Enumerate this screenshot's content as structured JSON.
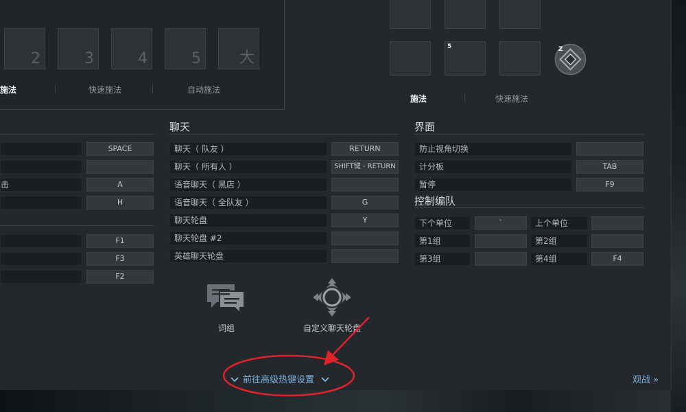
{
  "top_left": {
    "slots": [
      "2",
      "3",
      "4",
      "5",
      "大"
    ],
    "tabs": [
      "施法",
      "快速施法",
      "自动施法"
    ]
  },
  "top_right": {
    "slot_tag": "5",
    "avatar_letter": "Z",
    "tabs": [
      "施法",
      "快速施法"
    ]
  },
  "left_col": {
    "keys_a": [
      "SPACE",
      "",
      "A",
      "H"
    ],
    "partial_label": "击",
    "keys_b": [
      "F1",
      "F3",
      "F2"
    ]
  },
  "chat": {
    "title": "聊天",
    "rows": [
      {
        "label": "聊天（ 队友 ）",
        "key": "RETURN"
      },
      {
        "label": "聊天（ 所有人 ）",
        "key": "SHIFT键 - RETURN"
      },
      {
        "label": "语音聊天（ 黑店 ）",
        "key": ""
      },
      {
        "label": "语音聊天（ 全队友 ）",
        "key": "G"
      },
      {
        "label": "聊天轮盘",
        "key": "Y"
      },
      {
        "label": "聊天轮盘 #2",
        "key": ""
      },
      {
        "label": "英雄聊天轮盘",
        "key": ""
      }
    ],
    "phrases_label": "词组",
    "wheel_label": "自定义聊天轮盘"
  },
  "interface": {
    "title": "界面",
    "rows": [
      {
        "label": "防止视角切换",
        "key": ""
      },
      {
        "label": "计分板",
        "key": "TAB"
      },
      {
        "label": "暂停",
        "key": "F9"
      }
    ]
  },
  "control_groups": {
    "title": "控制编队",
    "rows": [
      {
        "left_label": "下个单位",
        "left_key": "`",
        "right_label": "上个单位",
        "right_key": ""
      },
      {
        "left_label": "第1组",
        "left_key": "",
        "right_label": "第2组",
        "right_key": ""
      },
      {
        "left_label": "第3组",
        "left_key": "",
        "right_label": "第4组",
        "right_key": "F4"
      }
    ]
  },
  "footer": {
    "advanced_link": "前往高级热键设置",
    "spectate": "观战 »"
  },
  "colors": {
    "accent": "#7fb3e0",
    "annotation": "#e0222a"
  }
}
